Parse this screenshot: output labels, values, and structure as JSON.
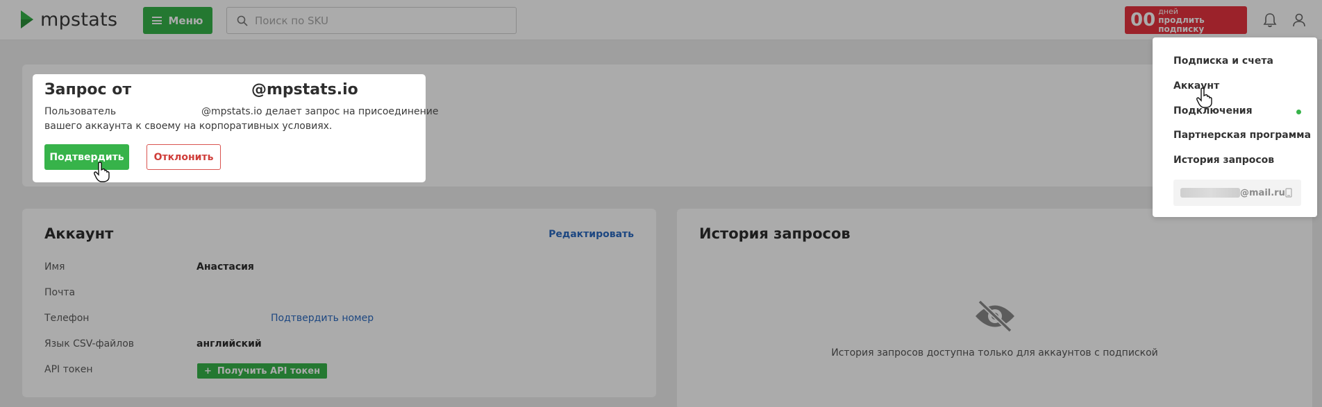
{
  "header": {
    "logo_text": "mpstats",
    "menu_label": "Меню",
    "search_placeholder": "Поиск по SKU",
    "subscription": {
      "days": "00",
      "days_label": "дней",
      "action": "продлить подписку"
    },
    "icons": [
      "logo-icon",
      "menu-icon",
      "search-icon",
      "bell-icon",
      "user-icon"
    ]
  },
  "request_modal": {
    "title_prefix": "Запрос от",
    "title_domain": "@mpstats.io",
    "text_prefix": "Пользователь",
    "text_domain_rest": "@mpstats.io делает запрос на присоединение",
    "text_line2": "вашего аккаунта к своему на корпоративных условиях.",
    "confirm_label": "Подтвердить",
    "decline_label": "Отклонить"
  },
  "account": {
    "title": "Аккаунт",
    "edit_label": "Редактировать",
    "rows": [
      {
        "label": "Имя",
        "value": "Анастасия"
      },
      {
        "label": "Почта",
        "value": ""
      },
      {
        "label": "Телефон",
        "value": "",
        "action": "Подтвердить номер"
      },
      {
        "label": "Язык CSV-файлов",
        "value": "английский"
      },
      {
        "label": "API токен",
        "action": "Получить API токен"
      }
    ]
  },
  "history": {
    "title": "История запросов",
    "empty_text": "История запросов доступна только для аккаунтов с подпиской",
    "icon": "eye-slash-icon"
  },
  "user_menu": {
    "items": [
      "Подписка и счета",
      "Аккаунт",
      "Подключения",
      "Партнерская программа",
      "История запросов"
    ],
    "email_domain": "@mail.ru",
    "connection_status_color": "#37b34a"
  },
  "colors": {
    "brand_green": "#37b34a",
    "alert_red": "#e8333f",
    "link_blue": "#2c6bc0"
  }
}
